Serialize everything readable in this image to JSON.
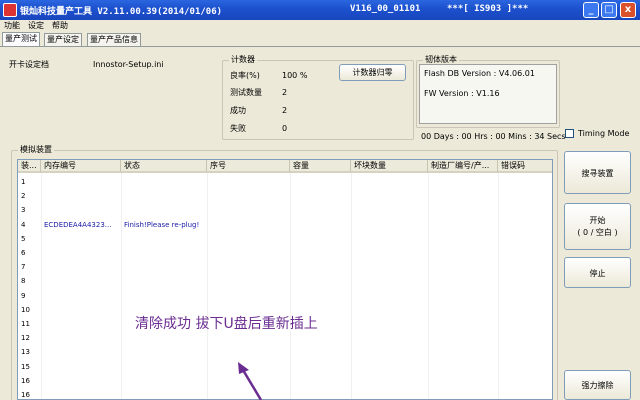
{
  "window": {
    "title": "银灿科技量产工具 V2.11.00.39(2014/01/06)",
    "version": "V116_00_01101",
    "ic": "***[ IS903 ]***",
    "buttons": {
      "minimize": "_",
      "maximize": "□",
      "close": "x"
    }
  },
  "menu": [
    "功能",
    "设定",
    "帮助"
  ],
  "tabs": [
    "量产测试",
    "量产设定",
    "量产产品信息"
  ],
  "card_setting": {
    "label": "开卡设定档",
    "value": "Innostor-Setup.ini"
  },
  "counter": {
    "group_label": "计数器",
    "yield_label": "良率(%)",
    "yield_value": "100 %",
    "tested_label": "测试数量",
    "tested_value": "2",
    "success_label": "成功",
    "success_value": "2",
    "fail_label": "失败",
    "fail_value": "0",
    "reset_button": "计数器归零"
  },
  "firmware": {
    "group_label": "韧体版本",
    "flash_db": "Flash DB Version :  V4.06.01",
    "fw": "FW Version :   V1.16"
  },
  "timer": "00 Days : 00 Hrs : 00 Mins : 34 Secs",
  "timing_mode": "Timing Mode",
  "device_group": "模拟装置",
  "table": {
    "columns": [
      "装...",
      "内存编号",
      "状态",
      "序号",
      "容量",
      "坏块数量",
      "制造厂编号/产...",
      "错误码"
    ],
    "rows": [
      {
        "no": "1",
        "mem": "",
        "status": ""
      },
      {
        "no": "2",
        "mem": "",
        "status": ""
      },
      {
        "no": "3",
        "mem": "",
        "status": ""
      },
      {
        "no": "4",
        "mem": "ECDEDEA4A4323...",
        "status": "Finish!Please re-plug!"
      },
      {
        "no": "5",
        "mem": "",
        "status": ""
      },
      {
        "no": "6",
        "mem": "",
        "status": ""
      },
      {
        "no": "7",
        "mem": "",
        "status": ""
      },
      {
        "no": "8",
        "mem": "",
        "status": ""
      },
      {
        "no": "9",
        "mem": "",
        "status": ""
      },
      {
        "no": "10",
        "mem": "",
        "status": ""
      },
      {
        "no": "11",
        "mem": "",
        "status": ""
      },
      {
        "no": "12",
        "mem": "",
        "status": ""
      },
      {
        "no": "13",
        "mem": "",
        "status": ""
      },
      {
        "no": "15",
        "mem": "",
        "status": ""
      },
      {
        "no": "16",
        "mem": "",
        "status": ""
      },
      {
        "no": "16",
        "mem": "",
        "status": ""
      }
    ]
  },
  "side_buttons": {
    "search": "搜寻装置",
    "start": "开始",
    "start_sub": "( 0 / 空白 )",
    "stop": "停止",
    "force_erase": "强力擦除"
  },
  "annotation": "清除成功  拔下U盘后重新插上",
  "colors": {
    "title_bar": "#1d52cf",
    "annotation": "#6a2c91",
    "status_text": "#1a1aa8"
  }
}
